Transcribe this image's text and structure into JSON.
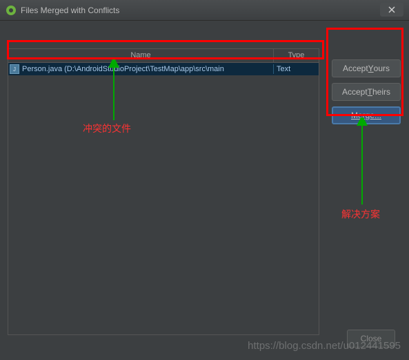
{
  "titlebar": {
    "title": "Files Merged with Conflicts"
  },
  "table": {
    "headers": {
      "name": "Name",
      "type": "Type"
    },
    "rows": [
      {
        "name": "Person.java (D:\\AndroidStudioProject\\TestMap\\app\\src\\main",
        "type": "Text"
      }
    ]
  },
  "buttons": {
    "accept_yours": "Accept Yours",
    "accept_theirs": "Accept Theirs",
    "merge": "Merge..."
  },
  "footer": {
    "close": "Close"
  },
  "annotations": {
    "conflict_file": "冲突的文件",
    "solution": "解决方案"
  },
  "watermark": "https://blog.csdn.net/u012441595"
}
